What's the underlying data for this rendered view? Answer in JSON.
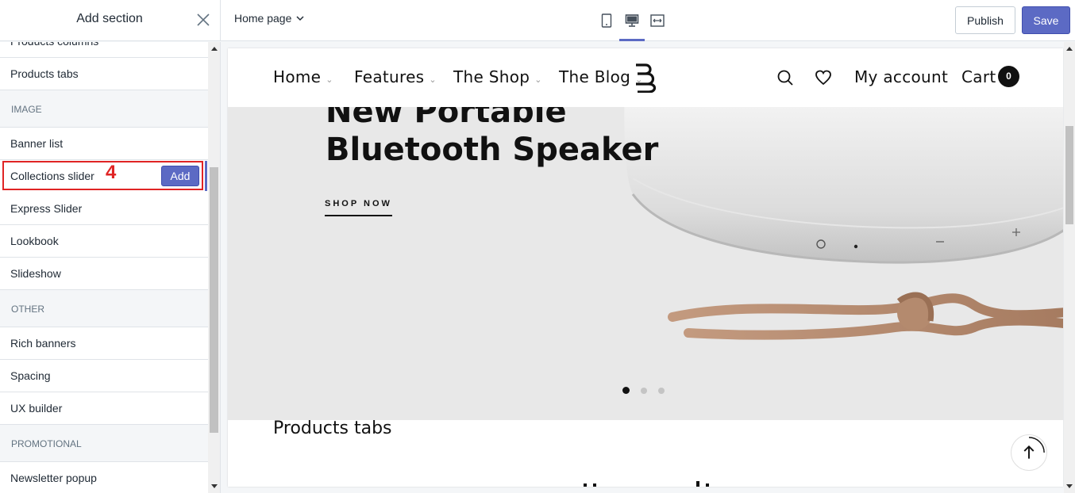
{
  "panel": {
    "title": "Add section"
  },
  "header": {
    "page_select": "Home page",
    "view_modes": [
      "mobile",
      "desktop",
      "fullscreen"
    ],
    "active_view": "desktop",
    "publish_label": "Publish",
    "save_label": "Save"
  },
  "sidebar": {
    "items": [
      {
        "label": "Products columns"
      },
      {
        "label": "Products tabs"
      },
      {
        "group": "IMAGE"
      },
      {
        "label": "Banner list"
      },
      {
        "label": "Collections slider"
      },
      {
        "label": "Express Slider"
      },
      {
        "label": "Lookbook"
      },
      {
        "label": "Slideshow"
      },
      {
        "group": "OTHER"
      },
      {
        "label": "Rich banners"
      },
      {
        "label": "Spacing"
      },
      {
        "label": "UX builder"
      },
      {
        "group": "PROMOTIONAL"
      },
      {
        "label": "Newsletter popup"
      }
    ],
    "add_label": "Add",
    "step_marker": "4"
  },
  "site": {
    "nav": [
      "Home",
      "Features",
      "The Shop",
      "The Blog"
    ],
    "account_label": "My account",
    "cart_label": "Cart",
    "cart_count": "0",
    "hero": {
      "title_line1": "New Portable",
      "title_line2": "Bluetooth Speaker",
      "cta": "SHOP NOW",
      "slides": 3,
      "active_slide": 1
    },
    "section_title": "Products tabs"
  },
  "colors": {
    "accent": "#5c6ac4",
    "highlight": "#e02424",
    "hero_bg": "#e8e8e8"
  }
}
